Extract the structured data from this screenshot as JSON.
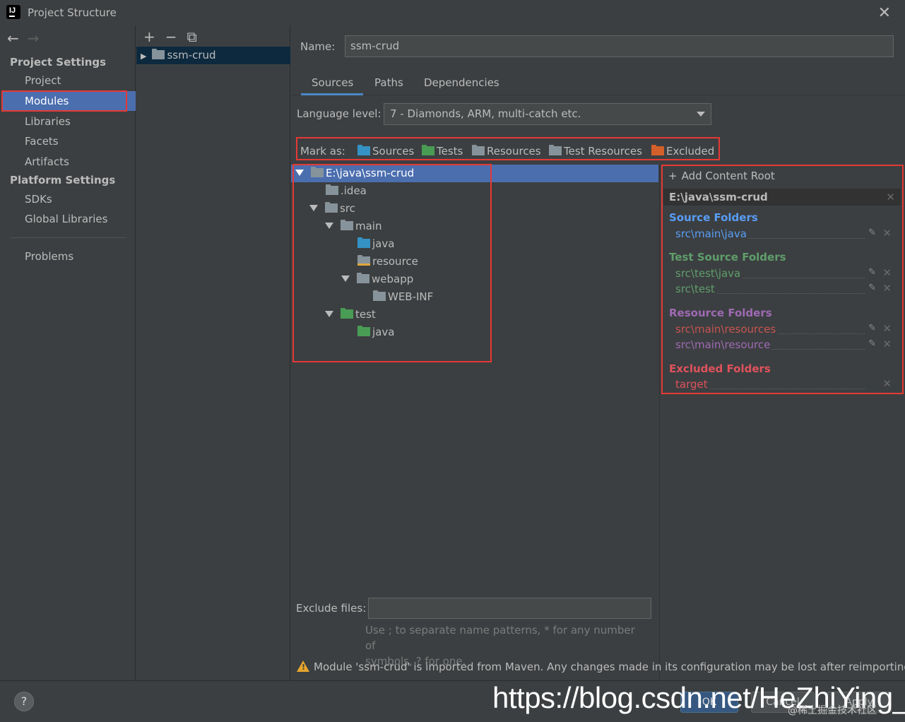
{
  "window": {
    "title": "Project Structure"
  },
  "sidebar": {
    "project_settings_heading": "Project Settings",
    "project_items": [
      {
        "label": "Project"
      },
      {
        "label": "Modules"
      },
      {
        "label": "Libraries"
      },
      {
        "label": "Facets"
      },
      {
        "label": "Artifacts"
      }
    ],
    "platform_settings_heading": "Platform Settings",
    "platform_items": [
      {
        "label": "SDKs"
      },
      {
        "label": "Global Libraries"
      }
    ],
    "problems": "Problems"
  },
  "modules": {
    "items": [
      {
        "label": "ssm-crud"
      }
    ]
  },
  "main": {
    "name_label": "Name:",
    "name_value": "ssm-crud",
    "tabs": [
      {
        "label": "Sources"
      },
      {
        "label": "Paths"
      },
      {
        "label": "Dependencies"
      }
    ],
    "language_level_label": "Language level:",
    "language_level_value": "7 - Diamonds, ARM, multi-catch etc.",
    "mark_as_label": "Mark as:",
    "mark_as": [
      {
        "label": "Sources",
        "color": "#3592c4"
      },
      {
        "label": "Tests",
        "color": "#499c54"
      },
      {
        "label": "Resources",
        "color": "#87939a"
      },
      {
        "label": "Test Resources",
        "color": "#87939a"
      },
      {
        "label": "Excluded",
        "color": "#d3602a"
      }
    ],
    "tree": [
      {
        "label": "E:\\java\\ssm-crud"
      },
      {
        "label": ".idea"
      },
      {
        "label": "src"
      },
      {
        "label": "main"
      },
      {
        "label": "java"
      },
      {
        "label": "resource"
      },
      {
        "label": "webapp"
      },
      {
        "label": "WEB-INF"
      },
      {
        "label": "test"
      },
      {
        "label": "java"
      }
    ],
    "add_content_root": "Add Content Root",
    "content_root": "E:\\java\\ssm-crud",
    "source_folders_heading": "Source Folders",
    "source_folders": [
      "src\\main\\java"
    ],
    "test_source_folders_heading": "Test Source Folders",
    "test_source_folders": [
      "src\\test\\java",
      "src\\test"
    ],
    "resource_folders_heading": "Resource Folders",
    "resource_folders": [
      "src\\main\\resources",
      "src\\main\\resource"
    ],
    "excluded_folders_heading": "Excluded Folders",
    "excluded_folders": [
      "target"
    ],
    "exclude_files_label": "Exclude files:",
    "exclude_hint_1": "Use ; to separate name patterns, * for any number of",
    "exclude_hint_2": "symbols, ? for one.",
    "warning": "Module 'ssm-crud' is imported from Maven. Any changes made in its configuration may be lost after reimporting."
  },
  "footer": {
    "help": "?",
    "ok": "OK",
    "cancel": "Cancel",
    "apply": "Apply",
    "watermark": "https://blog.csdn.net/HeZhiYing_",
    "watermark_small": "@稀土掘金技术社区"
  },
  "colors": {
    "source": "#589df6",
    "test": "#5f9e6b",
    "resource": "#9e6ab3",
    "excluded": "#e0525c",
    "selection": "#4b6eaf",
    "highlight_box": "#e53935"
  }
}
